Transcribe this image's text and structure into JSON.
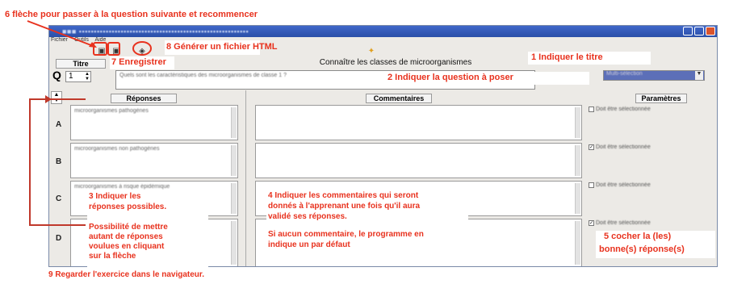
{
  "annotations": {
    "a6": "6 flèche pour passer à la question suivante et recommencer",
    "a8": "8 Générer un fichier HTML",
    "a7": "7 Enregistrer",
    "a1": "1 Indiquer le titre",
    "a2": "2 Indiquer la question à poser",
    "a3_line1": "3 Indiquer les",
    "a3_line2": "réponses possibles.",
    "a3_extra1": "Possibilité de mettre",
    "a3_extra2": "autant de réponses",
    "a3_extra3": "voulues en cliquant",
    "a3_extra4": "sur la flèche",
    "a4_line1": "4 Indiquer les commentaires  qui seront",
    "a4_line2": "donnés à l'apprenant une fois qu'il aura",
    "a4_line3": "validé ses réponses.",
    "a4_line4": "Si aucun commentaire, le programme en",
    "a4_line5": "indique un par défaut",
    "a5_line1": "5 cocher la (les)",
    "a5_line2": "bonne(s) réponse(s)",
    "a9": "9 Regarder l'exercice dans le navigateur."
  },
  "app": {
    "menu": [
      "Fichier",
      "Outils",
      "Aide"
    ],
    "title_label": "Titre",
    "title_value": "Connaître les classes de microorganismes",
    "question_label": "Q",
    "question_number": "1",
    "question_text": "Quels sont les caractéristiques des microorganismes de classe 1 ?",
    "mode_select": "Multi-sélection",
    "headers": {
      "reponses": "Réponses",
      "commentaires": "Commentaires",
      "parametres": "Paramètres"
    },
    "rows": [
      {
        "label": "A",
        "answer": "microorganismes pathogènes",
        "param": "Doit être sélectionnée",
        "checked": false
      },
      {
        "label": "B",
        "answer": "microorganismes non pathogènes",
        "param": "Doit être sélectionnée",
        "checked": true
      },
      {
        "label": "C",
        "answer": "microorganismes à risque épidémique",
        "param": "Doit être sélectionnée",
        "checked": false
      },
      {
        "label": "D",
        "answer": "",
        "param": "Doit être sélectionnée",
        "checked": true
      }
    ]
  },
  "colors": {
    "annotation_red": "#e8321e",
    "titlebar_blue": "#2b4fa8",
    "window_bg": "#eceae6"
  },
  "icons": [
    "save-icon",
    "save-as-icon",
    "html-export-icon",
    "next-arrow-icon",
    "help-icon"
  ]
}
